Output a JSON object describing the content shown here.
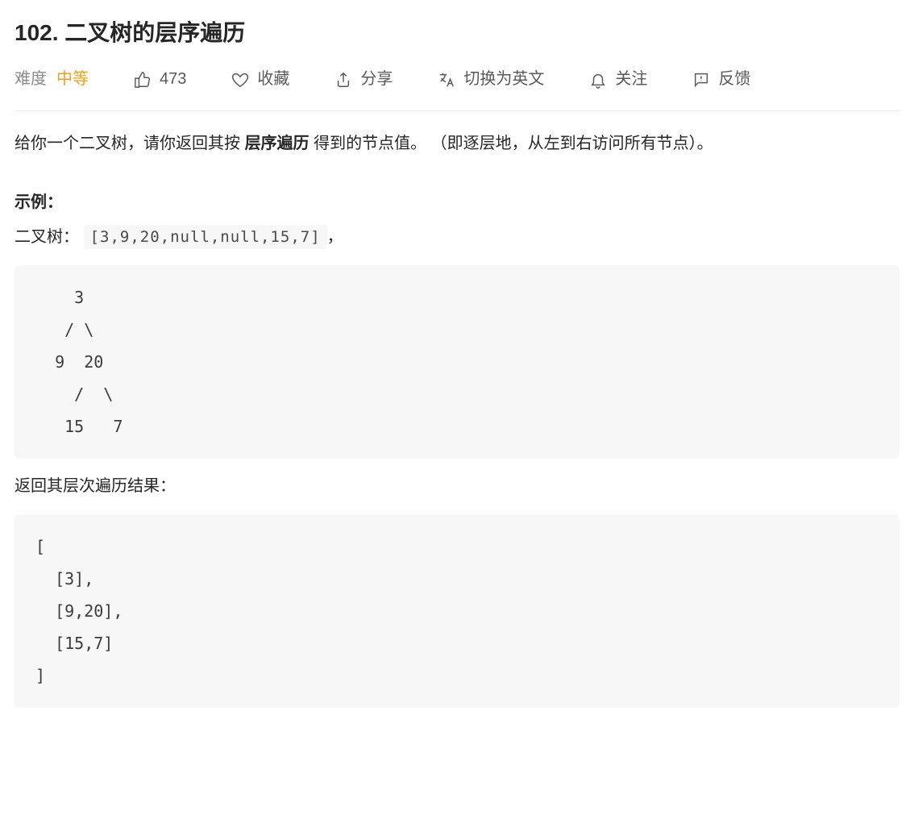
{
  "title": "102. 二叉树的层序遍历",
  "toolbar": {
    "difficulty_label": "难度",
    "difficulty_value": "中等",
    "like_count": "473",
    "favorite_label": "收藏",
    "share_label": "分享",
    "switch_lang_label": "切换为英文",
    "follow_label": "关注",
    "feedback_label": "反馈"
  },
  "body": {
    "desc_before_bold": "给你一个二叉树，请你返回其按 ",
    "desc_bold": "层序遍历",
    "desc_after_bold": " 得到的节点值。 （即逐层地，从左到右访问所有节点）。",
    "example_label": "示例：",
    "example_prefix": "二叉树：",
    "example_code_inline": "[3,9,20,null,null,15,7]",
    "example_suffix": "，",
    "tree_block": "    3\n   / \\\n  9  20\n    /  \\\n   15   7",
    "return_label": "返回其层次遍历结果：",
    "result_block": "[\n  [3],\n  [9,20],\n  [15,7]\n]"
  }
}
